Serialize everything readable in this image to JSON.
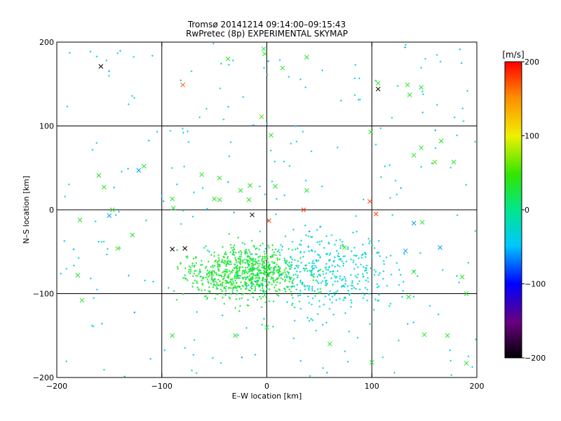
{
  "chart_data": {
    "type": "scatter",
    "title": "Tromsø 20141214 09:14:00–09:15:43",
    "subtitle": "RwPretec (8p) EXPERIMENTAL SKYMAP",
    "xlabel": "E–W location [km]",
    "ylabel": "N–S location [km]",
    "xlim": [
      -200,
      200
    ],
    "ylim": [
      -200,
      200
    ],
    "xticks": [
      -200,
      -100,
      0,
      100,
      200
    ],
    "yticks": [
      -200,
      -100,
      0,
      100,
      200
    ],
    "grid": true,
    "colorbar": {
      "label": "[m/s]",
      "range": [
        -200,
        200
      ],
      "ticks": [
        200,
        100,
        0,
        -100,
        -200
      ]
    },
    "series": [
      {
        "marker": "x",
        "points": [
          [
            -158,
            171,
            -200
          ],
          [
            -80,
            149,
            170
          ],
          [
            -3,
            192,
            20
          ],
          [
            -2,
            186,
            40
          ],
          [
            15,
            169,
            35
          ],
          [
            -37,
            180,
            35
          ],
          [
            38,
            182,
            35
          ],
          [
            -5,
            111,
            60
          ],
          [
            106,
            151,
            50
          ],
          [
            106,
            144,
            -200
          ],
          [
            134,
            149,
            35
          ],
          [
            147,
            146,
            35
          ],
          [
            136,
            137,
            35
          ],
          [
            99,
            93,
            35
          ],
          [
            4,
            89,
            35
          ],
          [
            166,
            82,
            35
          ],
          [
            147,
            74,
            35
          ],
          [
            140,
            65,
            35
          ],
          [
            160,
            57,
            60
          ],
          [
            178,
            57,
            35
          ],
          [
            -122,
            47,
            -60
          ],
          [
            -117,
            52,
            35
          ],
          [
            -62,
            42,
            35
          ],
          [
            -45,
            38,
            35
          ],
          [
            -160,
            41,
            35
          ],
          [
            -155,
            27,
            35
          ],
          [
            -147,
            0,
            35
          ],
          [
            -90,
            13,
            35
          ],
          [
            -89,
            2,
            35
          ],
          [
            -45,
            12,
            35
          ],
          [
            -50,
            13,
            35
          ],
          [
            -25,
            23,
            35
          ],
          [
            -16,
            29,
            35
          ],
          [
            8,
            28,
            35
          ],
          [
            -17,
            12,
            35
          ],
          [
            38,
            23,
            35
          ],
          [
            98,
            10,
            180
          ],
          [
            35,
            0,
            180
          ],
          [
            -14,
            -6,
            -200
          ],
          [
            2,
            -13,
            180
          ],
          [
            104,
            -5,
            180
          ],
          [
            -178,
            -12,
            35
          ],
          [
            -150,
            -7,
            -60
          ],
          [
            -128,
            -30,
            35
          ],
          [
            -142,
            -46,
            60
          ],
          [
            -90,
            -47,
            -200
          ],
          [
            -78,
            -46,
            -200
          ],
          [
            -180,
            -78,
            35
          ],
          [
            -176,
            -108,
            35
          ],
          [
            -15,
            -60,
            35
          ],
          [
            -10,
            -63,
            35
          ],
          [
            74,
            -45,
            60
          ],
          [
            140,
            -16,
            -60
          ],
          [
            148,
            -15,
            35
          ],
          [
            132,
            -49,
            -60
          ],
          [
            165,
            -45,
            -60
          ],
          [
            186,
            -80,
            35
          ],
          [
            190,
            -100,
            35
          ],
          [
            140,
            -74,
            35
          ],
          [
            135,
            -104,
            35
          ],
          [
            -90,
            -150,
            35
          ],
          [
            -30,
            -150,
            35
          ],
          [
            0,
            -140,
            35
          ],
          [
            60,
            -160,
            35
          ],
          [
            100,
            -182,
            35
          ],
          [
            150,
            -149,
            35
          ],
          [
            172,
            -150,
            35
          ],
          [
            190,
            -183,
            35
          ]
        ]
      }
    ]
  }
}
